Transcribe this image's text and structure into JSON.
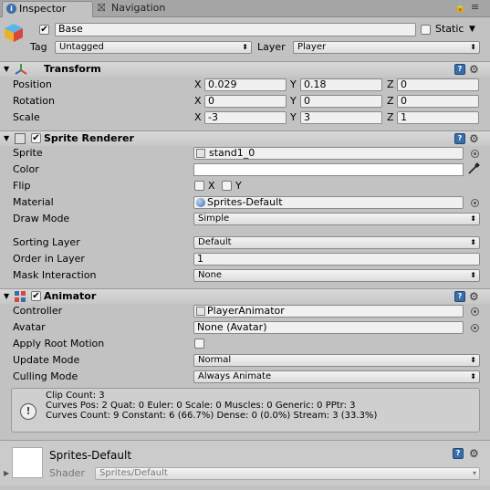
{
  "tabs": [
    {
      "label": "Inspector",
      "icon": "info-icon"
    },
    {
      "label": "Navigation",
      "icon": "navigation-icon"
    }
  ],
  "gameobject": {
    "name": "Base",
    "static_label": "Static",
    "tag_label": "Tag",
    "tag_value": "Untagged",
    "layer_label": "Layer",
    "layer_value": "Player"
  },
  "transform": {
    "title": "Transform",
    "position_label": "Position",
    "rotation_label": "Rotation",
    "scale_label": "Scale",
    "position": {
      "x": "0.029",
      "y": "0.18",
      "z": "0"
    },
    "rotation": {
      "x": "0",
      "y": "0",
      "z": "0"
    },
    "scale": {
      "x": "-3",
      "y": "3",
      "z": "1"
    },
    "axis_x": "X",
    "axis_y": "Y",
    "axis_z": "Z"
  },
  "sprite_renderer": {
    "title": "Sprite Renderer",
    "sprite_label": "Sprite",
    "sprite_value": "stand1_0",
    "color_label": "Color",
    "flip_label": "Flip",
    "flip_x": "X",
    "flip_y": "Y",
    "material_label": "Material",
    "material_value": "Sprites-Default",
    "draw_mode_label": "Draw Mode",
    "draw_mode_value": "Simple",
    "sorting_layer_label": "Sorting Layer",
    "sorting_layer_value": "Default",
    "order_label": "Order in Layer",
    "order_value": "1",
    "mask_label": "Mask Interaction",
    "mask_value": "None"
  },
  "animator": {
    "title": "Animator",
    "controller_label": "Controller",
    "controller_value": "PlayerAnimator",
    "avatar_label": "Avatar",
    "avatar_value": "None (Avatar)",
    "root_motion_label": "Apply Root Motion",
    "update_mode_label": "Update Mode",
    "update_mode_value": "Normal",
    "culling_label": "Culling Mode",
    "culling_value": "Always Animate",
    "info_line1": "Clip Count: 3",
    "info_line2": "Curves Pos: 2 Quat: 0 Euler: 0 Scale: 0 Muscles: 0 Generic: 0 PPtr: 3",
    "info_line3": "Curves Count: 9 Constant: 6 (66.7%) Dense: 0 (0.0%) Stream: 3 (33.3%)"
  },
  "material_section": {
    "name": "Sprites-Default",
    "shader_label": "Shader",
    "shader_value": "Sprites/Default"
  },
  "colors": {
    "panel_bg": "#c2c2c2",
    "header_bg": "#cbcbcb",
    "help_blue": "#3a6ea8"
  }
}
